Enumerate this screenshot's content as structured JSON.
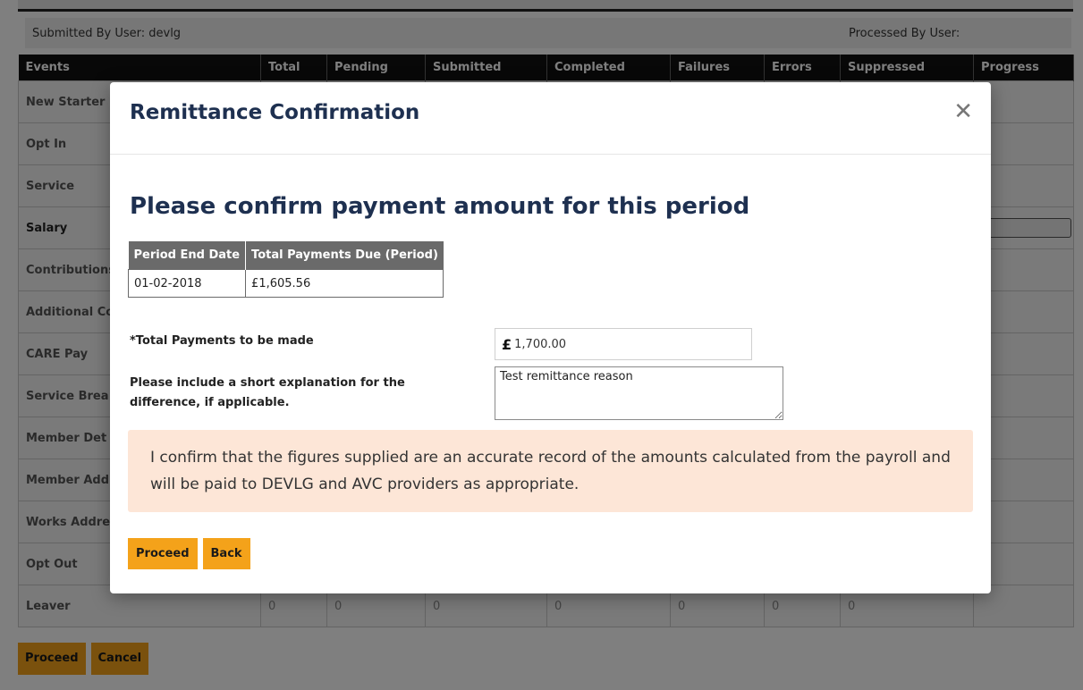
{
  "userbar": {
    "submitted_label": "Submitted By User:  devlg",
    "processed_label": "Processed By User:"
  },
  "events_table": {
    "headers": [
      "Events",
      "Total",
      "Pending",
      "Submitted",
      "Completed",
      "Failures",
      "Errors",
      "Suppressed",
      "Progress"
    ],
    "rows": [
      {
        "event": "New Starter"
      },
      {
        "event": "Opt In"
      },
      {
        "event": "Service"
      },
      {
        "event": "Salary"
      },
      {
        "event": "Contributions"
      },
      {
        "event": "Additional Co"
      },
      {
        "event": "CARE Pay"
      },
      {
        "event": "Service Brea"
      },
      {
        "event": "Member Det"
      },
      {
        "event": "Member Add"
      },
      {
        "event": "Works Addre"
      },
      {
        "event": "Opt Out"
      },
      {
        "event": "Leaver",
        "total": "0",
        "pending": "0",
        "submitted": "0",
        "completed": "0",
        "failures": "0",
        "errors": "0",
        "suppressed": "0"
      }
    ]
  },
  "page_buttons": {
    "proceed": "Proceed",
    "cancel": "Cancel"
  },
  "modal": {
    "title": "Remittance Confirmation",
    "close_icon": "close-icon",
    "heading": "Please confirm payment amount for this period",
    "period_table": {
      "headers": [
        "Period End Date",
        "Total Payments Due (Period)"
      ],
      "rows": [
        [
          "01-02-2018",
          "£1,605.56"
        ]
      ]
    },
    "total_payments_label": "*Total Payments to be made",
    "currency_symbol": "£",
    "total_payments_value": "1,700.00",
    "explanation_label": "Please include a short explanation for the difference, if applicable.",
    "explanation_value": "Test remittance reason",
    "confirm_text": "I confirm that the figures supplied are an accurate record of the amounts calculated from the payroll and will be paid to DEVLG and AVC providers as appropriate.",
    "proceed_label": "Proceed",
    "back_label": "Back"
  },
  "colors": {
    "accent_button": "#f4a21a",
    "title_navy": "#1e3050",
    "confirm_background": "#fde6d7",
    "table_header_grey": "#6a6a6a"
  }
}
